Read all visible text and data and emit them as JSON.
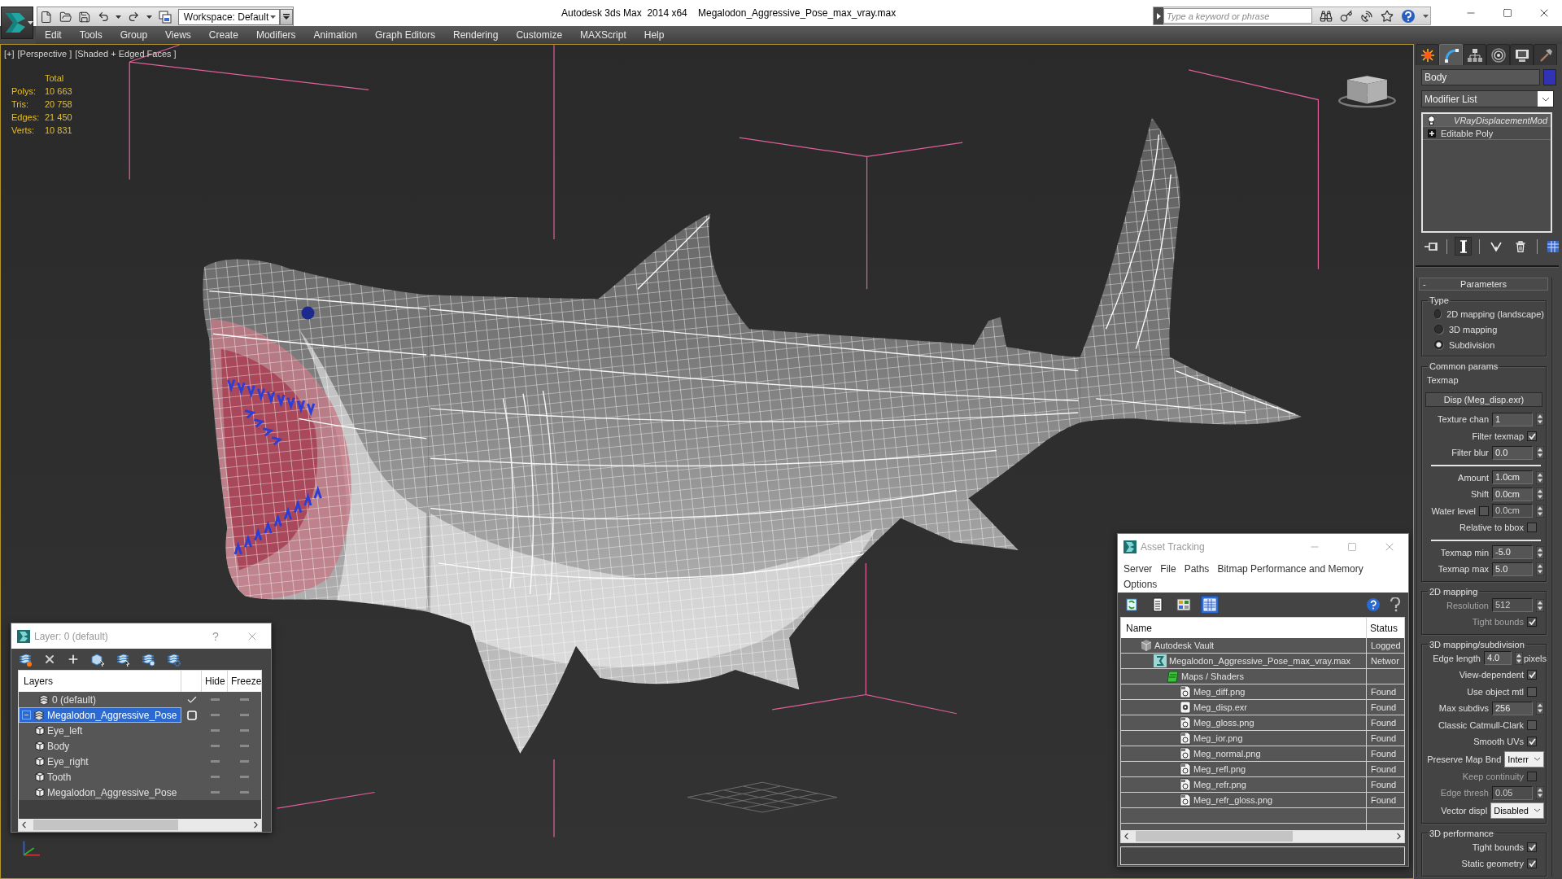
{
  "window": {
    "title": "Autodesk 3ds Max  2014 x64",
    "file": "Megalodon_Aggressive_Pose_max_vray.max"
  },
  "quick_access": {
    "workspace": "Workspace: Default"
  },
  "search": {
    "placeholder": "Type a keyword or phrase"
  },
  "menu": [
    "Edit",
    "Tools",
    "Group",
    "Views",
    "Create",
    "Modifiers",
    "Animation",
    "Graph Editors",
    "Rendering",
    "Customize",
    "MAXScript",
    "Help"
  ],
  "viewport": {
    "labels": [
      "[+]",
      "[Perspective ]",
      "[Shaded + Edged Faces ]"
    ],
    "stats": {
      "heading": "Total",
      "rows": [
        {
          "label": "Polys:",
          "value": "10 663"
        },
        {
          "label": "Tris:",
          "value": "20 758"
        },
        {
          "label": "Edges:",
          "value": "21 450"
        },
        {
          "label": "Verts:",
          "value": "10 831"
        }
      ]
    }
  },
  "layer_dialog": {
    "title": "Layer: 0 (default)",
    "help": "?",
    "columns": {
      "name": "Layers",
      "hide": "Hide",
      "freeze": "Freeze"
    },
    "layers": [
      {
        "kind": "layer",
        "name": "0 (default)",
        "current": true,
        "selected": false,
        "hidden": false,
        "frozen": false
      },
      {
        "kind": "layer",
        "name": "Megalodon_Aggressive_Pose",
        "current": false,
        "selected": true,
        "expanded": true,
        "hidden": false,
        "frozen": false,
        "children": [
          {
            "kind": "object",
            "name": "Eye_left",
            "selected": false,
            "hidden": false,
            "frozen": false
          },
          {
            "kind": "object",
            "name": "Body",
            "selected": false,
            "hidden": false,
            "frozen": false
          },
          {
            "kind": "object",
            "name": "Eye_right",
            "selected": false,
            "hidden": false,
            "frozen": false
          },
          {
            "kind": "object",
            "name": "Tooth",
            "selected": false,
            "hidden": false,
            "frozen": false
          },
          {
            "kind": "object",
            "name": "Megalodon_Aggressive_Pose",
            "selected": false,
            "hidden": false,
            "frozen": false
          }
        ]
      }
    ]
  },
  "asset_tracking": {
    "title": "Asset Tracking",
    "menu": [
      "Server",
      "File",
      "Paths",
      "Bitmap Performance and Memory",
      "Options"
    ],
    "toolbar": [
      {
        "kind": "refresh",
        "selected": false
      },
      {
        "kind": "list",
        "selected": false
      },
      {
        "kind": "thumbnails",
        "selected": false
      },
      {
        "kind": "table",
        "selected": true
      }
    ],
    "columns": {
      "name": "Name",
      "status": "Status"
    },
    "assets": [
      {
        "kind": "server",
        "name": "Autodesk Vault",
        "status": "Logged",
        "children": [
          {
            "kind": "scene",
            "name": "Megalodon_Aggressive_Pose_max_vray.max",
            "status": "Networ",
            "children": [
              {
                "kind": "folder",
                "name": "Maps / Shaders",
                "children": [
                  {
                    "kind": "bitmap",
                    "name": "Meg_diff.png",
                    "status": "Found"
                  },
                  {
                    "kind": "exr",
                    "name": "Meg_disp.exr",
                    "status": "Found"
                  },
                  {
                    "kind": "bitmap",
                    "name": "Meg_gloss.png",
                    "status": "Found"
                  },
                  {
                    "kind": "bitmap",
                    "name": "Meg_ior.png",
                    "status": "Found"
                  },
                  {
                    "kind": "bitmap",
                    "name": "Meg_normal.png",
                    "status": "Found"
                  },
                  {
                    "kind": "bitmap",
                    "name": "Meg_refl.png",
                    "status": "Found"
                  },
                  {
                    "kind": "bitmap",
                    "name": "Meg_refr.png",
                    "status": "Found"
                  },
                  {
                    "kind": "bitmap",
                    "name": "Meg_refr_gloss.png",
                    "status": "Found"
                  }
                ]
              }
            ]
          }
        ]
      }
    ]
  },
  "command_panel": {
    "tabs": [
      {
        "kind": "create",
        "selected": false
      },
      {
        "kind": "modify",
        "selected": true
      },
      {
        "kind": "hierarchy",
        "selected": false
      },
      {
        "kind": "motion",
        "selected": false
      },
      {
        "kind": "display",
        "selected": false
      },
      {
        "kind": "utilities",
        "selected": false
      }
    ],
    "object": {
      "name": "Body",
      "color": "#3232b4"
    },
    "modifier_list": "Modifier List",
    "stack": [
      {
        "kind": "modifier",
        "name": "VRayDisplacementMod",
        "selected": true
      },
      {
        "kind": "base",
        "name": "Editable Poly",
        "selected": false
      }
    ],
    "stack_tools": [
      {
        "kind": "pin",
        "on": false
      },
      {
        "kind": "end_result",
        "on": true
      },
      {
        "kind": "make_unique",
        "on": false
      },
      {
        "kind": "remove",
        "on": false
      },
      {
        "kind": "configure",
        "on": false
      }
    ],
    "rollout": {
      "title": "Parameters",
      "toggle": "-",
      "groups": [
        {
          "title": "Type",
          "rows": [
            {
              "kind": "radio",
              "label": "2D mapping (landscape)",
              "selected": false
            },
            {
              "kind": "radio",
              "label": "3D mapping",
              "selected": false
            },
            {
              "kind": "radio",
              "label": "Subdivision",
              "selected": true
            }
          ]
        },
        {
          "title": "Common params",
          "rows": [
            {
              "kind": "label",
              "label": "Texmap"
            },
            {
              "kind": "map_button",
              "label": "Disp (Meg_disp.exr)"
            },
            {
              "kind": "spinner",
              "label": "Texture chan",
              "value": "1",
              "disabled": false
            },
            {
              "kind": "check",
              "label": "Filter texmap",
              "checked": true,
              "disabled": false
            },
            {
              "kind": "spinner",
              "label": "Filter blur",
              "value": "0.0",
              "disabled": false
            },
            {
              "kind": "rule"
            },
            {
              "kind": "spinner",
              "label": "Amount",
              "value": "1.0cm",
              "disabled": false
            },
            {
              "kind": "spinner",
              "label": "Shift",
              "value": "0.0cm",
              "disabled": false
            },
            {
              "kind": "check_spinner",
              "label": "Water level",
              "checked": false,
              "value": "0.0cm"
            },
            {
              "kind": "check",
              "label": "Relative to bbox",
              "checked": false,
              "disabled": false
            },
            {
              "kind": "rule"
            },
            {
              "kind": "spinner",
              "label": "Texmap min",
              "value": "-5.0",
              "disabled": false
            },
            {
              "kind": "spinner",
              "label": "Texmap max",
              "value": "5.0",
              "disabled": false
            }
          ]
        },
        {
          "title": "2D mapping",
          "rows": [
            {
              "kind": "spinner",
              "label": "Resolution",
              "value": "512",
              "disabled": true
            },
            {
              "kind": "check",
              "label": "Tight bounds",
              "checked": true,
              "disabled": true
            }
          ]
        },
        {
          "title": "3D mapping/subdivision",
          "rows": [
            {
              "kind": "spinner_unit",
              "label": "Edge length",
              "value": "4.0",
              "unit": "pixels",
              "disabled": false
            },
            {
              "kind": "check",
              "label": "View-dependent",
              "checked": true,
              "disabled": false
            },
            {
              "kind": "check",
              "label": "Use object mtl",
              "checked": false,
              "disabled": false
            },
            {
              "kind": "spinner",
              "label": "Max subdivs",
              "value": "256",
              "disabled": false
            },
            {
              "kind": "check",
              "label": "Classic Catmull-Clark",
              "checked": false,
              "disabled": false
            },
            {
              "kind": "check",
              "label": "Smooth UVs",
              "checked": true,
              "disabled": false
            },
            {
              "kind": "dropdown",
              "label": "Preserve Map Bnd",
              "value": "Interr",
              "disabled": false
            },
            {
              "kind": "check",
              "label": "Keep continuity",
              "checked": false,
              "disabled": true
            },
            {
              "kind": "spinner",
              "label": "Edge thresh",
              "value": "0.05",
              "disabled": true
            },
            {
              "kind": "dropdown",
              "label": "Vector displ",
              "value": "Disabled",
              "disabled": false
            }
          ]
        },
        {
          "title": "3D performance",
          "rows": [
            {
              "kind": "check",
              "label": "Tight bounds",
              "checked": true,
              "disabled": false
            },
            {
              "kind": "check",
              "label": "Static geometry",
              "checked": true,
              "disabled": false
            }
          ]
        }
      ]
    }
  }
}
